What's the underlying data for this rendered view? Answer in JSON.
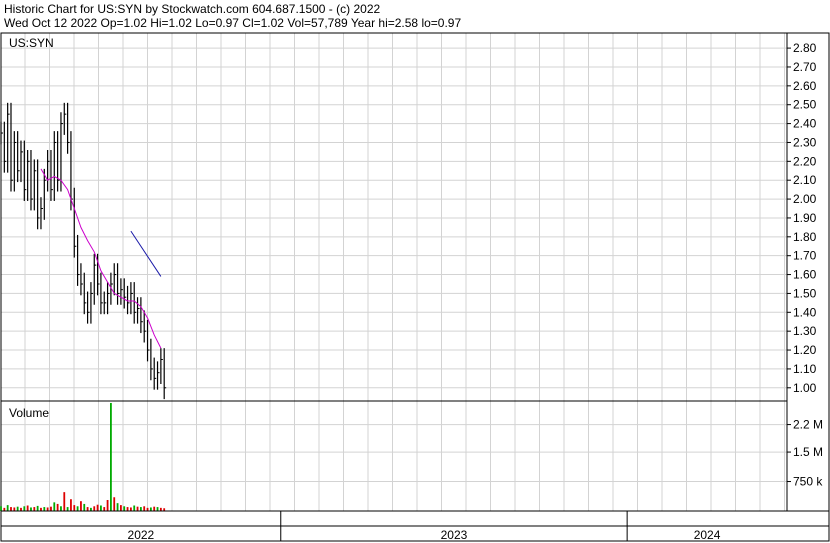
{
  "header": {
    "line1": "Historic Chart for US:SYN by Stockwatch.com 604.687.1500 - (c) 2022",
    "line2": "Wed Oct 12 2022  Op=1.02  Hi=1.02  Lo=0.97  Cl=1.02  Vol=57,789  Year hi=2.58  lo=0.97"
  },
  "colors": {
    "price": "#000000",
    "moving_average": "#cc00cc",
    "trend_line": "#1a1aa8",
    "volume_up": "#00aa00",
    "volume_down": "#dd0000",
    "grid": "#d3d3d3",
    "border": "#000000"
  },
  "chart_data": [
    {
      "type": "line",
      "symbol_label": "US:SYN",
      "ylim": [
        0.93,
        2.88
      ],
      "yticks": [
        "2.80",
        "2.70",
        "2.60",
        "2.50",
        "2.40",
        "2.30",
        "2.20",
        "2.10",
        "2.00",
        "1.90",
        "1.80",
        "1.70",
        "1.60",
        "1.50",
        "1.40",
        "1.30",
        "1.20",
        "1.10",
        "1.00"
      ],
      "x_periods": [
        "2022",
        "2023",
        "2024"
      ],
      "x_period_ranges_weeks": [
        [
          0,
          42
        ],
        [
          42,
          94
        ],
        [
          94,
          118
        ]
      ],
      "series": [
        {
          "kind": "price",
          "x_weeks": [
            0,
            0.5,
            1,
            1.5,
            2,
            2.5,
            3,
            3.5,
            4,
            4.5,
            5,
            5.5,
            6,
            6.5,
            7,
            7.5,
            8,
            8.5,
            9,
            9.5,
            10,
            10.5,
            11,
            11.5,
            12,
            12.5,
            13,
            13.5,
            14,
            14.5,
            15,
            15.5,
            16,
            16.5,
            17,
            17.5,
            18,
            18.5,
            19,
            19.5,
            20,
            20.5,
            21,
            21.5,
            22,
            22.5,
            23,
            23.5,
            24,
            24.5
          ],
          "values": [
            2.35,
            2.2,
            2.45,
            2.1,
            2.3,
            2.15,
            2.25,
            2.05,
            2.2,
            2.0,
            2.15,
            1.9,
            1.95,
            2.1,
            2.2,
            2.05,
            2.3,
            2.1,
            2.4,
            2.45,
            2.3,
            2.0,
            1.75,
            1.6,
            1.55,
            1.45,
            1.4,
            1.5,
            1.65,
            1.55,
            1.45,
            1.45,
            1.5,
            1.55,
            1.6,
            1.5,
            1.52,
            1.48,
            1.45,
            1.5,
            1.4,
            1.42,
            1.35,
            1.3,
            1.2,
            1.1,
            1.05,
            1.08,
            1.15,
            1.0
          ]
        },
        {
          "kind": "moving_average",
          "x_weeks": [
            6,
            7,
            8,
            9,
            10,
            11,
            12,
            13,
            14,
            15,
            16,
            17,
            18,
            19,
            20,
            21,
            22,
            23,
            24
          ],
          "values": [
            2.16,
            2.1,
            2.12,
            2.1,
            2.05,
            1.95,
            1.85,
            1.78,
            1.72,
            1.62,
            1.56,
            1.5,
            1.48,
            1.46,
            1.46,
            1.43,
            1.37,
            1.28,
            1.21
          ]
        },
        {
          "kind": "trend_line",
          "x_weeks": [
            19.5,
            24
          ],
          "values": [
            1.83,
            1.59
          ]
        }
      ]
    },
    {
      "type": "bar",
      "title": "Volume",
      "ylim": [
        0,
        2.8
      ],
      "ytick_labels": [
        "2.2 M",
        "1.5 M",
        "750 k"
      ],
      "ytick_values": [
        2.2,
        1.5,
        0.75
      ],
      "x_weeks": [
        0,
        0.5,
        1,
        1.5,
        2,
        2.5,
        3,
        3.5,
        4,
        4.5,
        5,
        5.5,
        6,
        6.5,
        7,
        7.5,
        8,
        8.5,
        9,
        9.5,
        10,
        10.5,
        11,
        11.5,
        12,
        12.5,
        13,
        13.5,
        14,
        14.5,
        15,
        15.5,
        16,
        16.5,
        17,
        17.5,
        18,
        18.5,
        19,
        19.5,
        20,
        20.5,
        21,
        21.5,
        22,
        22.5,
        23,
        23.5,
        24,
        24.5
      ],
      "values": [
        0.12,
        0.08,
        0.15,
        0.1,
        0.09,
        0.11,
        0.08,
        0.12,
        0.14,
        0.09,
        0.1,
        0.13,
        0.08,
        0.1,
        0.09,
        0.11,
        0.22,
        0.18,
        0.12,
        0.48,
        0.1,
        0.3,
        0.15,
        0.12,
        0.25,
        0.18,
        0.1,
        0.08,
        0.12,
        0.16,
        0.14,
        0.1,
        0.28,
        2.75,
        0.35,
        0.2,
        0.15,
        0.12,
        0.1,
        0.09,
        0.14,
        0.11,
        0.1,
        0.12,
        0.08,
        0.09,
        0.11,
        0.1,
        0.08,
        0.07
      ],
      "direction": [
        "up",
        "down",
        "up",
        "down",
        "down",
        "up",
        "down",
        "up",
        "down",
        "up",
        "down",
        "up",
        "down",
        "up",
        "down",
        "down",
        "up",
        "down",
        "up",
        "down",
        "up",
        "down",
        "down",
        "up",
        "down",
        "up",
        "down",
        "up",
        "down",
        "down",
        "up",
        "down",
        "down",
        "up",
        "down",
        "up",
        "down",
        "up",
        "down",
        "down",
        "up",
        "down",
        "up",
        "down",
        "down",
        "up",
        "down",
        "up",
        "down",
        "down"
      ]
    }
  ]
}
